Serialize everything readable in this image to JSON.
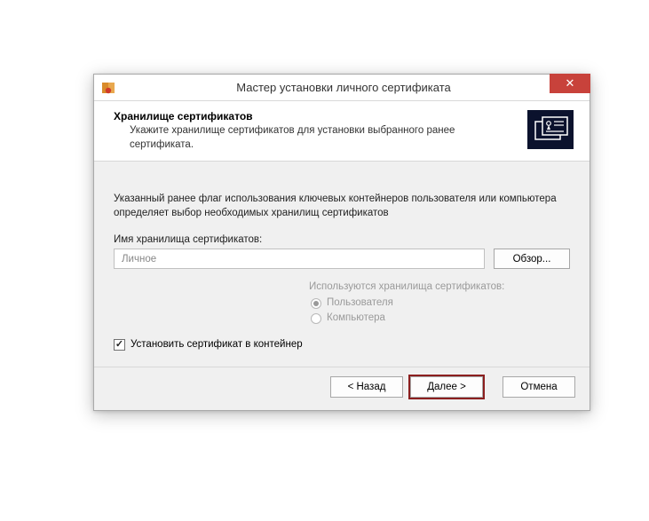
{
  "window": {
    "title": "Мастер установки личного сертификата",
    "close_symbol": "✕"
  },
  "header": {
    "heading": "Хранилище сертификатов",
    "subheading": "Укажите хранилище сертификатов для установки выбранного ранее сертификата."
  },
  "body": {
    "info": "Указанный ранее флаг использования ключевых контейнеров пользователя или компьютера определяет выбор необходимых хранилищ сертификатов",
    "storage_name_label": "Имя хранилища сертификатов:",
    "storage_name_value": "Личное",
    "browse_label": "Обзор...",
    "storage_group_title": "Используются хранилища сертификатов:",
    "radio_user": "Пользователя",
    "radio_computer": "Компьютера",
    "checkbox_label": "Установить сертификат в контейнер"
  },
  "footer": {
    "back": "< Назад",
    "next": "Далее >",
    "cancel": "Отмена"
  }
}
